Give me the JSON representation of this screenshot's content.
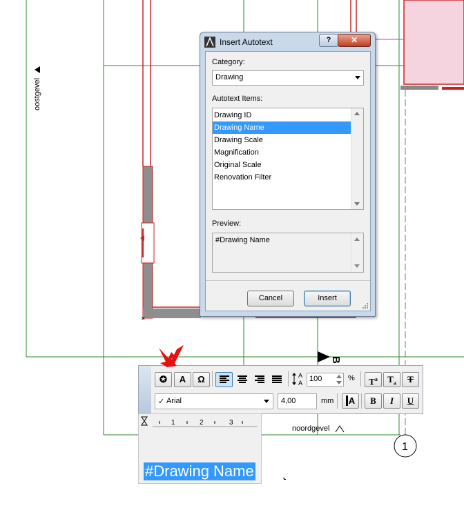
{
  "plan": {
    "left_label": "oostgevel",
    "bottom_label": "noordgevel",
    "marker_letter": "B",
    "grid_number": "1"
  },
  "dialog": {
    "title": "Insert Autotext",
    "help_glyph": "?",
    "close_glyph": "✕",
    "category_label": "Category:",
    "category_value": "Drawing",
    "items_label": "Autotext Items:",
    "items": [
      "Drawing ID",
      "Drawing Name",
      "Drawing Scale",
      "Magnification",
      "Original Scale",
      "Renovation Filter"
    ],
    "selected_item": "Drawing Name",
    "preview_label": "Preview:",
    "preview_text": "#Drawing Name",
    "cancel_label": "Cancel",
    "insert_label": "Insert"
  },
  "toolbar": {
    "autotext_glyph": "✪",
    "case_glyph": "A",
    "special_char_glyph": "Ω",
    "line_spacing_value": "100",
    "percent_unit": "%",
    "superscript_label": "T",
    "superscript_mark": "a",
    "subscript_label": "T",
    "subscript_mark": "a",
    "strike_label": "T",
    "font_name": "Arial",
    "font_check": "✓",
    "font_size": "4,00",
    "size_unit": "mm",
    "text_color_label": "A",
    "bold_label": "B",
    "italic_label": "I",
    "underline_label": "U"
  },
  "ruler": {
    "ticks": [
      "1",
      "2",
      "3"
    ]
  },
  "editor": {
    "text": "#Drawing Name"
  },
  "colors": {
    "selection": "#3399ff",
    "wall_red": "#cc2222",
    "grid_green": "#2a8a2a",
    "annotation_arrow": "#e41212"
  }
}
